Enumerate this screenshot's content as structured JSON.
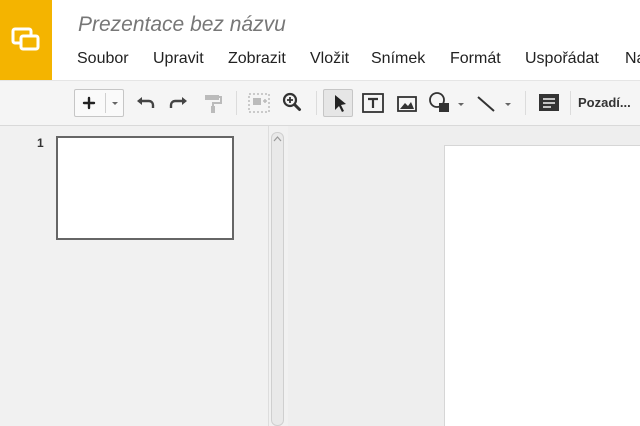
{
  "app": {
    "name": "Google Slides",
    "brand_color": "#f4b400"
  },
  "document": {
    "title": "Prezentace bez názvu"
  },
  "menu": [
    {
      "label": "Soubor"
    },
    {
      "label": "Upravit"
    },
    {
      "label": "Zobrazit"
    },
    {
      "label": "Vložit"
    },
    {
      "label": "Snímek"
    },
    {
      "label": "Formát"
    },
    {
      "label": "Uspořádat"
    },
    {
      "label": "Na"
    }
  ],
  "toolbar": {
    "icons": [
      "add-icon",
      "dropdown-arrow-icon",
      "undo-icon",
      "redo-icon",
      "paint-format-icon",
      "fit-icon",
      "zoom-icon",
      "select-cursor-icon",
      "text-box-icon",
      "image-icon",
      "shape-icon",
      "line-icon",
      "comment-icon"
    ],
    "background_label": "Pozadí..."
  },
  "filmstrip": {
    "slides": [
      {
        "number": "1"
      }
    ]
  }
}
